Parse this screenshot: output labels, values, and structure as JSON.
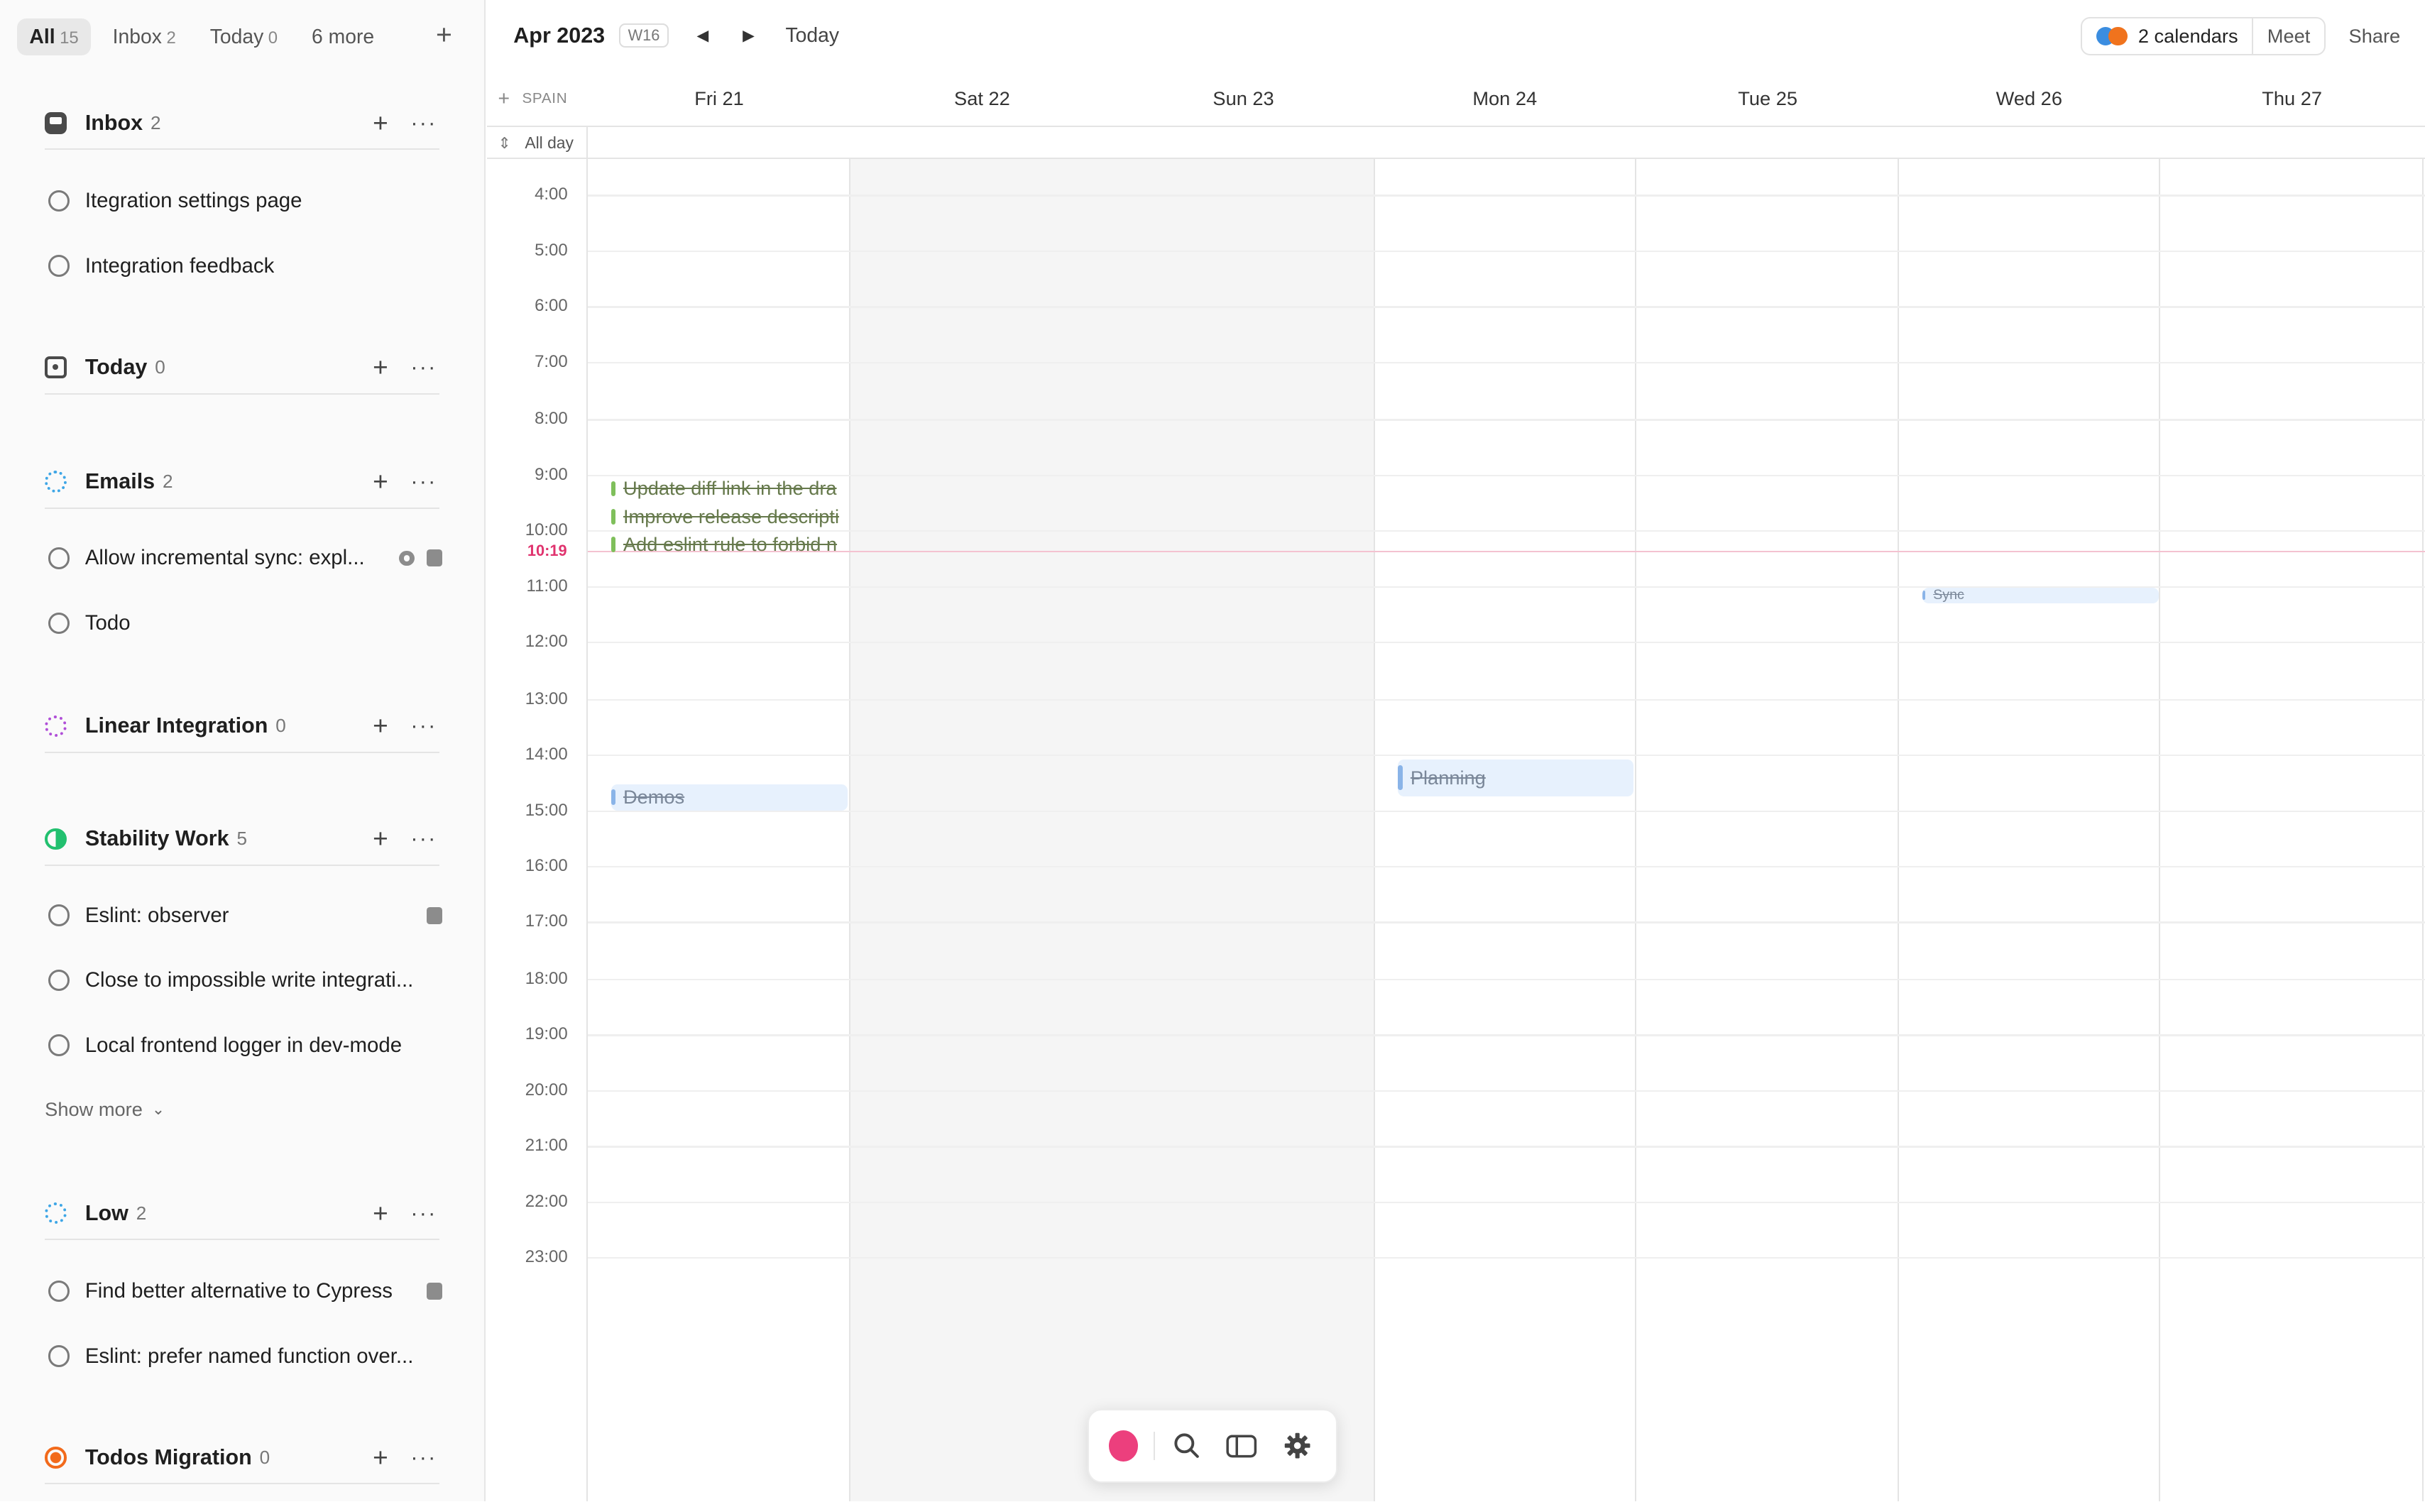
{
  "sidebar": {
    "tabs": [
      {
        "label": "All",
        "count": "15"
      },
      {
        "label": "Inbox",
        "count": "2"
      },
      {
        "label": "Today",
        "count": "0"
      },
      {
        "label": "6 more",
        "count": ""
      }
    ],
    "add_symbol": "+",
    "groups": [
      {
        "title": "Inbox",
        "count": "2",
        "icon": "inbox-icon",
        "tasks": [
          {
            "label": "Itegration settings page"
          },
          {
            "label": "Integration feedback"
          }
        ]
      },
      {
        "title": "Today",
        "count": "0",
        "icon": "today-icon",
        "tasks": []
      },
      {
        "title": "Emails",
        "count": "2",
        "icon": "dashed-circle-icon",
        "tasks": [
          {
            "label": "Allow incremental sync: expl..."
          },
          {
            "label": "Todo"
          }
        ]
      },
      {
        "title": "Linear Integration",
        "count": "0",
        "icon": "dashed-circle-icon",
        "tasks": []
      },
      {
        "title": "Stability Work",
        "count": "5",
        "icon": "progress-circle-icon",
        "tasks": [
          {
            "label": "Eslint: observer"
          },
          {
            "label": "Close to impossible write integrati..."
          },
          {
            "label": "Local frontend logger in dev-mode"
          }
        ]
      },
      {
        "title": "Low",
        "count": "2",
        "icon": "dashed-circle-icon",
        "tasks": [
          {
            "label": "Find better alternative to Cypress"
          },
          {
            "label": "Eslint: prefer named function over..."
          }
        ]
      },
      {
        "title": "Todos Migration",
        "count": "0",
        "icon": "orange-circle-icon",
        "tasks": []
      }
    ],
    "show_more": "Show more"
  },
  "topbar": {
    "month": "Apr 2023",
    "week": "W16",
    "today": "Today",
    "calendars": "2 calendars",
    "meet": "Meet",
    "share": "Share"
  },
  "calendar": {
    "timezone": "SPAIN",
    "all_day": "All day",
    "days": [
      "Fri 21",
      "Sat 22",
      "Sun 23",
      "Mon 24",
      "Tue 25",
      "Wed 26",
      "Thu 27"
    ],
    "hours": [
      "4:00",
      "5:00",
      "6:00",
      "7:00",
      "8:00",
      "9:00",
      "10:00",
      "11:00",
      "12:00",
      "13:00",
      "14:00",
      "15:00",
      "16:00",
      "17:00",
      "18:00",
      "19:00",
      "20:00",
      "21:00",
      "22:00",
      "23:00"
    ],
    "now": "10:19",
    "events": [
      {
        "title": "Update diff link in the dra",
        "day": "Fri 21"
      },
      {
        "title": "Improve release descripti",
        "day": "Fri 21"
      },
      {
        "title": "Add eslint rule to forbid n",
        "day": "Fri 21"
      },
      {
        "title": "Demos",
        "day": "Fri 21"
      },
      {
        "title": "Planning",
        "day": "Mon 24"
      },
      {
        "title": "Sync",
        "day": "Wed 26"
      }
    ]
  },
  "colors": {
    "accent_pink": "#ec3f7d",
    "now_line": "#e0336e",
    "calendar_blue": "#3b8de0",
    "calendar_orange": "#f0731d"
  }
}
